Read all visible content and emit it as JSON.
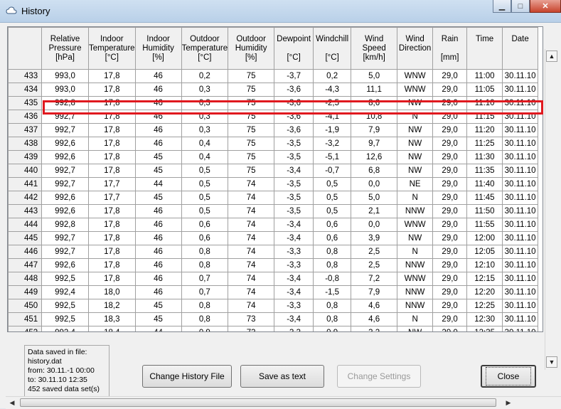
{
  "window": {
    "title": "History"
  },
  "columns": [
    {
      "lines": [
        "",
        "",
        ""
      ]
    },
    {
      "lines": [
        "Relative",
        "Pressure",
        "[hPa]"
      ]
    },
    {
      "lines": [
        "Indoor",
        "Temperature",
        "[°C]"
      ]
    },
    {
      "lines": [
        "Indoor",
        "Humidity",
        "[%]"
      ]
    },
    {
      "lines": [
        "Outdoor",
        "Temperature",
        "[°C]"
      ]
    },
    {
      "lines": [
        "Outdoor",
        "Humidity",
        "[%]"
      ]
    },
    {
      "lines": [
        "Dewpoint",
        "",
        "[°C]"
      ]
    },
    {
      "lines": [
        "Windchill",
        "",
        "[°C]"
      ]
    },
    {
      "lines": [
        "Wind",
        "Speed",
        "[km/h]"
      ]
    },
    {
      "lines": [
        "Wind",
        "Direction",
        ""
      ]
    },
    {
      "lines": [
        "Rain",
        "",
        "[mm]"
      ]
    },
    {
      "lines": [
        "Time",
        "",
        ""
      ]
    },
    {
      "lines": [
        "Date",
        "",
        ""
      ]
    }
  ],
  "rows": [
    [
      "433",
      "993,0",
      "17,8",
      "46",
      "0,2",
      "75",
      "-3,7",
      "0,2",
      "5,0",
      "WNW",
      "29,0",
      "11:00",
      "30.11.10"
    ],
    [
      "434",
      "993,0",
      "17,8",
      "46",
      "0,3",
      "75",
      "-3,6",
      "-4,3",
      "11,1",
      "WNW",
      "29,0",
      "11:05",
      "30.11.10"
    ],
    [
      "435",
      "992,8",
      "17,8",
      "46",
      "0,3",
      "75",
      "-3,6",
      "-2,5",
      "8,6",
      "NW",
      "29,0",
      "11:10",
      "30.11.10"
    ],
    [
      "436",
      "992,7",
      "17,8",
      "46",
      "0,3",
      "75",
      "-3,6",
      "-4,1",
      "10,8",
      "N",
      "29,0",
      "11:15",
      "30.11.10"
    ],
    [
      "437",
      "992,7",
      "17,8",
      "46",
      "0,3",
      "75",
      "-3,6",
      "-1,9",
      "7,9",
      "NW",
      "29,0",
      "11:20",
      "30.11.10"
    ],
    [
      "438",
      "992,6",
      "17,8",
      "46",
      "0,4",
      "75",
      "-3,5",
      "-3,2",
      "9,7",
      "NW",
      "29,0",
      "11:25",
      "30.11.10"
    ],
    [
      "439",
      "992,6",
      "17,8",
      "45",
      "0,4",
      "75",
      "-3,5",
      "-5,1",
      "12,6",
      "NW",
      "29,0",
      "11:30",
      "30.11.10"
    ],
    [
      "440",
      "992,7",
      "17,8",
      "45",
      "0,5",
      "75",
      "-3,4",
      "-0,7",
      "6,8",
      "NW",
      "29,0",
      "11:35",
      "30.11.10"
    ],
    [
      "441",
      "992,7",
      "17,7",
      "44",
      "0,5",
      "74",
      "-3,5",
      "0,5",
      "0,0",
      "NE",
      "29,0",
      "11:40",
      "30.11.10"
    ],
    [
      "442",
      "992,6",
      "17,7",
      "45",
      "0,5",
      "74",
      "-3,5",
      "0,5",
      "5,0",
      "N",
      "29,0",
      "11:45",
      "30.11.10"
    ],
    [
      "443",
      "992,6",
      "17,8",
      "46",
      "0,5",
      "74",
      "-3,5",
      "0,5",
      "2,1",
      "NNW",
      "29,0",
      "11:50",
      "30.11.10"
    ],
    [
      "444",
      "992,8",
      "17,8",
      "46",
      "0,6",
      "74",
      "-3,4",
      "0,6",
      "0,0",
      "WNW",
      "29,0",
      "11:55",
      "30.11.10"
    ],
    [
      "445",
      "992,7",
      "17,8",
      "46",
      "0,6",
      "74",
      "-3,4",
      "0,6",
      "3,9",
      "NW",
      "29,0",
      "12:00",
      "30.11.10"
    ],
    [
      "446",
      "992,7",
      "17,8",
      "46",
      "0,8",
      "74",
      "-3,3",
      "0,8",
      "2,5",
      "N",
      "29,0",
      "12:05",
      "30.11.10"
    ],
    [
      "447",
      "992,6",
      "17,8",
      "46",
      "0,8",
      "74",
      "-3,3",
      "0,8",
      "2,5",
      "NNW",
      "29,0",
      "12:10",
      "30.11.10"
    ],
    [
      "448",
      "992,5",
      "17,8",
      "46",
      "0,7",
      "74",
      "-3,4",
      "-0,8",
      "7,2",
      "WNW",
      "29,0",
      "12:15",
      "30.11.10"
    ],
    [
      "449",
      "992,4",
      "18,0",
      "46",
      "0,7",
      "74",
      "-3,4",
      "-1,5",
      "7,9",
      "NNW",
      "29,0",
      "12:20",
      "30.11.10"
    ],
    [
      "450",
      "992,5",
      "18,2",
      "45",
      "0,8",
      "74",
      "-3,3",
      "0,8",
      "4,6",
      "NNW",
      "29,0",
      "12:25",
      "30.11.10"
    ],
    [
      "451",
      "992,5",
      "18,3",
      "45",
      "0,8",
      "73",
      "-3,4",
      "0,8",
      "4,6",
      "N",
      "29,0",
      "12:30",
      "30.11.10"
    ],
    [
      "452",
      "992,4",
      "18,4",
      "44",
      "0,9",
      "73",
      "-3,3",
      "0,9",
      "3,2",
      "NW",
      "29,0",
      "12:35",
      "30.11.10"
    ]
  ],
  "highlighted_row": "436",
  "info": {
    "line1": "Data saved in file:",
    "line2": "history.dat",
    "line3": "from: 30.11.-1 00:00",
    "line4": "to:     30.11.10 12:35",
    "line5": "452 saved data set(s)"
  },
  "buttons": {
    "change_history_file": "Change History File",
    "save_as_text": "Save as text",
    "change_settings": "Change Settings",
    "close": "Close"
  }
}
